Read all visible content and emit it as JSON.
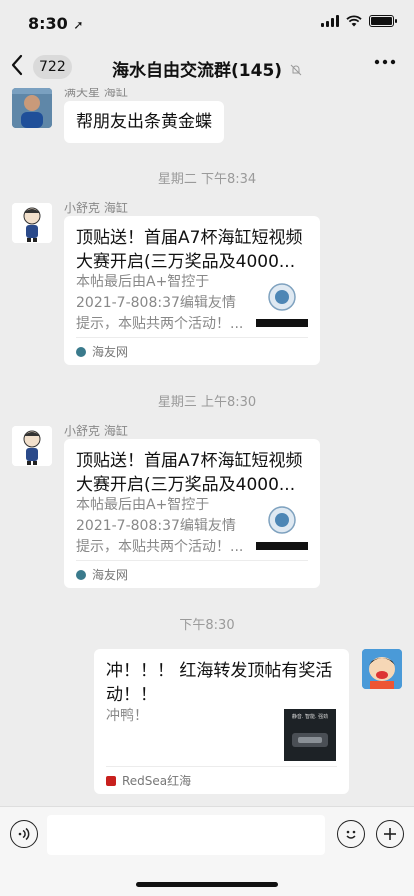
{
  "status": {
    "time": "8:30"
  },
  "nav": {
    "back_count": "722",
    "title": "海水自由交流群(145)"
  },
  "messages": [
    {
      "sender": "满天星 海缸",
      "text": "帮朋友出条黄金蝶"
    },
    {
      "timestamp": "星期二 下午8:34"
    },
    {
      "sender": "小舒克 海缸",
      "card_title": "顶贴送！首届A7杯海缸短视频大赛开启(三万奖品及4000...",
      "card_desc": "本帖最后由A+智控于2021-7-808:37编辑友情提示，本贴共两个活动！...",
      "card_source": "海友网"
    },
    {
      "timestamp": "星期三 上午8:30"
    },
    {
      "sender": "小舒克 海缸",
      "card_title": "顶贴送！首届A7杯海缸短视频大赛开启(三万奖品及4000...",
      "card_desc": "本帖最后由A+智控于2021-7-808:37编辑友情提示，本贴共两个活动！...",
      "card_source": "海友网"
    },
    {
      "timestamp": "下午8:30"
    },
    {
      "card_title": "冲！！！ 红海转发顶帖有奖活动！！",
      "card_desc": "冲鸭！",
      "card_source": "RedSea红海",
      "thumb_text": "静音. 智能. 强劲"
    }
  ],
  "colors": {
    "background": "#ededed",
    "bubble": "#ffffff",
    "source_icon_haiyou": "#3a7a8c",
    "source_icon_redsea": "#c8201e"
  }
}
